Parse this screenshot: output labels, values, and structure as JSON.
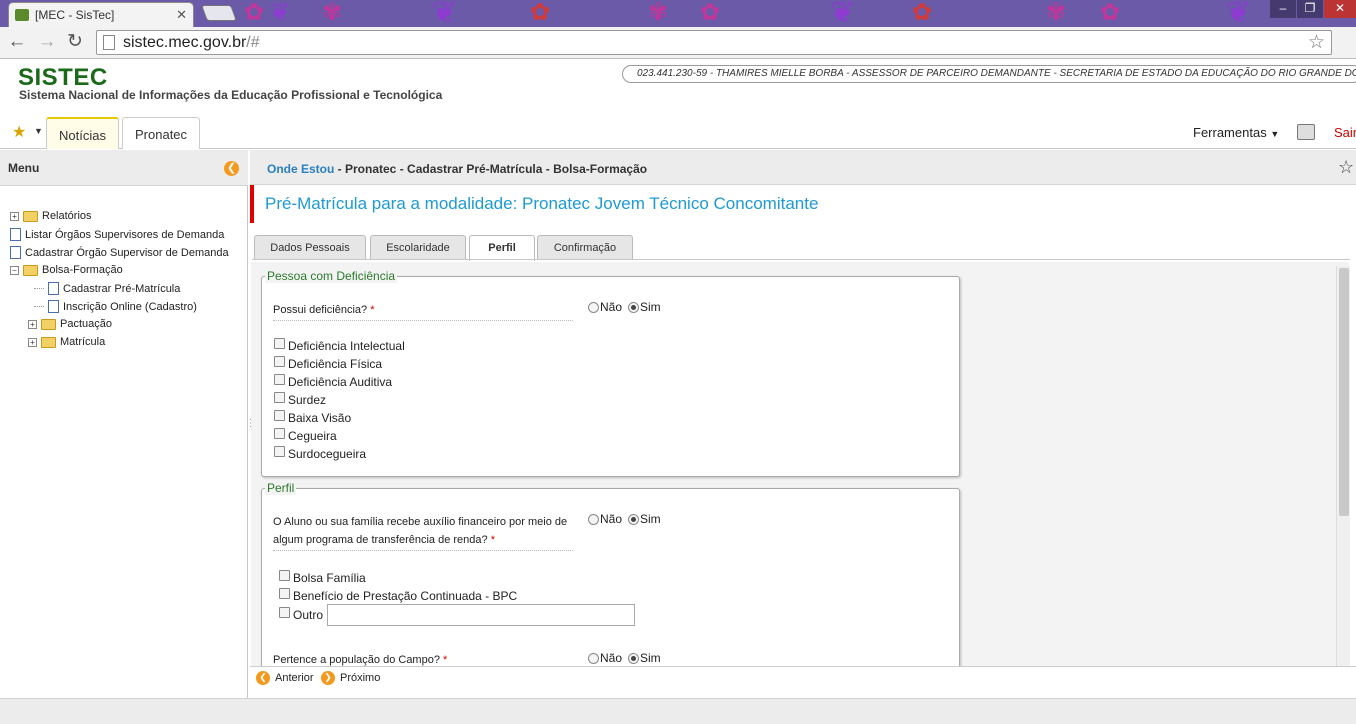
{
  "browser": {
    "tab_title": "[MEC - SisTec]",
    "tab_close": "✕",
    "url_host": "sistec.mec.gov.br",
    "url_path": "/#"
  },
  "header": {
    "logo": "SISTEC",
    "subtitle": "Sistema Nacional de Informações da Educação Profissional e Tecnológica",
    "user_info": "023.441.230-59 - THAMIRES MIELLE BORBA - ASSESSOR DE PARCEIRO DEMANDANTE - SECRETARIA DE ESTADO DA EDUCAÇÃO DO RIO GRANDE DO SUL"
  },
  "topnav": {
    "tabs": [
      {
        "label": "Notícias",
        "active": true
      },
      {
        "label": "Pronatec",
        "active": false
      }
    ],
    "tools_label": "Ferramentas",
    "logout_label": "Sair"
  },
  "menu": {
    "title": "Menu",
    "items": [
      {
        "label": "Relatórios",
        "type": "folder",
        "expander": "+"
      },
      {
        "label": "Listar Órgãos Supervisores de Demanda",
        "type": "doc"
      },
      {
        "label": "Cadastrar Órgão Supervisor de Demanda",
        "type": "doc"
      },
      {
        "label": "Bolsa-Formação",
        "type": "folder",
        "expander": "−"
      },
      {
        "label": "Cadastrar Pré-Matrícula",
        "type": "doc"
      },
      {
        "label": "Inscrição Online (Cadastro)",
        "type": "doc"
      },
      {
        "label": "Pactuação",
        "type": "folder",
        "expander": "+"
      },
      {
        "label": "Matrícula",
        "type": "folder",
        "expander": "+"
      }
    ]
  },
  "breadcrumb": {
    "prefix": "Onde Estou",
    "path": " - Pronatec - Cadastrar Pré-Matrícula - Bolsa-Formação"
  },
  "page": {
    "title": "Pré-Matrícula para a modalidade: Pronatec Jovem Técnico Concomitante",
    "tabs": [
      {
        "label": "Dados Pessoais",
        "active": false
      },
      {
        "label": "Escolaridade",
        "active": false
      },
      {
        "label": "Perfil",
        "active": true
      },
      {
        "label": "Confirmação",
        "active": false
      }
    ]
  },
  "form": {
    "deficiencia": {
      "legend": "Pessoa com Deficiência",
      "question": "Possui deficiência?",
      "required_mark": "*",
      "option_no": "Não",
      "option_yes": "Sim",
      "selected": "Sim",
      "checkboxes": [
        "Deficiência Intelectual",
        "Deficiência Física",
        "Deficiência Auditiva",
        "Surdez",
        "Baixa Visão",
        "Cegueira",
        "Surdocegueira"
      ]
    },
    "perfil": {
      "legend": "Perfil",
      "question_line1": "O Aluno ou sua família recebe auxílio financeiro por meio de",
      "question_line2": "algum programa de transferência de renda?",
      "required_mark": "*",
      "option_no": "Não",
      "option_yes": "Sim",
      "selected": "Sim",
      "checkboxes": [
        "Bolsa Família",
        "Benefício de Prestação Continuada - BPC",
        "Outro"
      ],
      "outro_value": "",
      "campo_question": "Pertence a população do Campo?",
      "campo_required_mark": "*",
      "campo_no": "Não",
      "campo_yes": "Sim",
      "campo_selected": "Sim"
    }
  },
  "footer": {
    "prev_label": "Anterior",
    "next_label": "Próximo"
  },
  "colors": {
    "brand_green": "#1a6a1a",
    "title_blue": "#1d9ad6",
    "accent_red": "#e00000",
    "orange": "#f39a1e"
  }
}
